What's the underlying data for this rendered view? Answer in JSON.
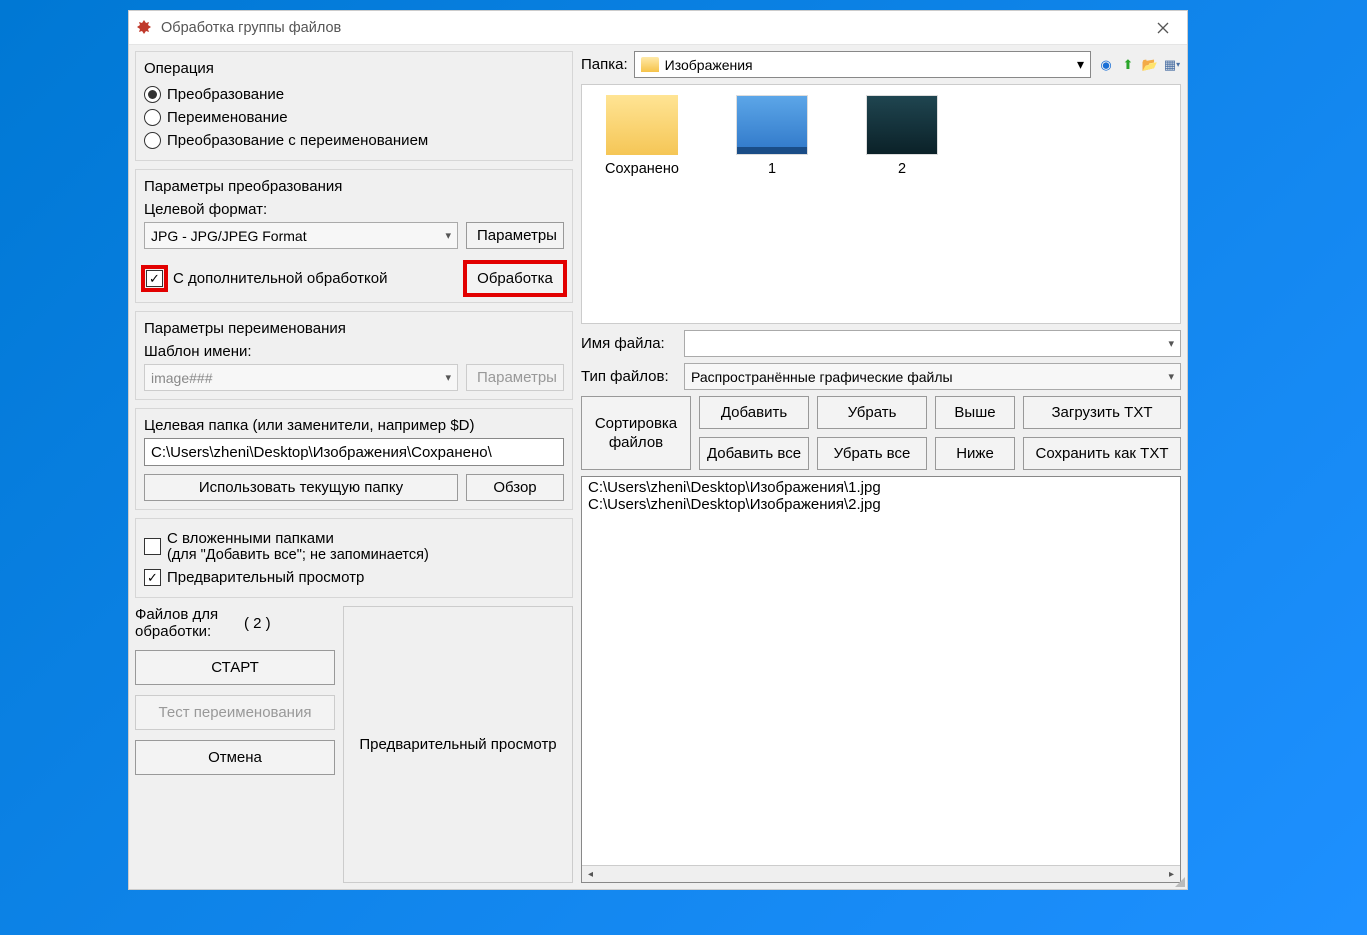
{
  "window": {
    "title": "Обработка группы файлов"
  },
  "operation": {
    "legend": "Операция",
    "options": {
      "convert": "Преобразование",
      "rename": "Переименование",
      "both": "Преобразование с переименованием"
    }
  },
  "conversion": {
    "legend": "Параметры преобразования",
    "targetFormatLabel": "Целевой формат:",
    "targetFormat": "JPG - JPG/JPEG Format",
    "paramsBtn": "Параметры",
    "advancedCheck": "С дополнительной обработкой",
    "processingBtn": "Обработка"
  },
  "rename": {
    "legend": "Параметры переименования",
    "templateLabel": "Шаблон имени:",
    "templateValue": "image###",
    "paramsBtn": "Параметры"
  },
  "targetFolder": {
    "label": "Целевая папка (или заменители, например $D)",
    "path": "C:\\Users\\zheni\\Desktop\\Изображения\\Сохранено\\",
    "useCurrent": "Использовать текущую папку",
    "browse": "Обзор"
  },
  "options": {
    "subfolders": "С вложенными папками",
    "subfoldersNote": "(для \"Добавить все\"; не запоминается)",
    "preview": "Предварительный просмотр"
  },
  "actions": {
    "filesForLabel": "Файлов для обработки:",
    "filesCount": "( 2 )",
    "start": "СТАРТ",
    "testRename": "Тест переименования",
    "cancel": "Отмена",
    "previewBox": "Предварительный просмотр"
  },
  "right": {
    "folderLabel": "Папка:",
    "folderName": "Изображения",
    "items": [
      {
        "name": "Сохранено",
        "type": "folder"
      },
      {
        "name": "1",
        "type": "win"
      },
      {
        "name": "2",
        "type": "dark"
      }
    ],
    "fileNameLabel": "Имя файла:",
    "fileTypeLabel": "Тип файлов:",
    "fileTypeValue": "Распространённые графические файлы",
    "buttons": {
      "sort": "Сортировка файлов",
      "add": "Добавить",
      "remove": "Убрать",
      "up": "Выше",
      "loadTxt": "Загрузить TXT",
      "addAll": "Добавить все",
      "removeAll": "Убрать все",
      "down": "Ниже",
      "saveTxt": "Сохранить как TXT"
    },
    "fileList": [
      "C:\\Users\\zheni\\Desktop\\Изображения\\1.jpg",
      "C:\\Users\\zheni\\Desktop\\Изображения\\2.jpg"
    ]
  }
}
